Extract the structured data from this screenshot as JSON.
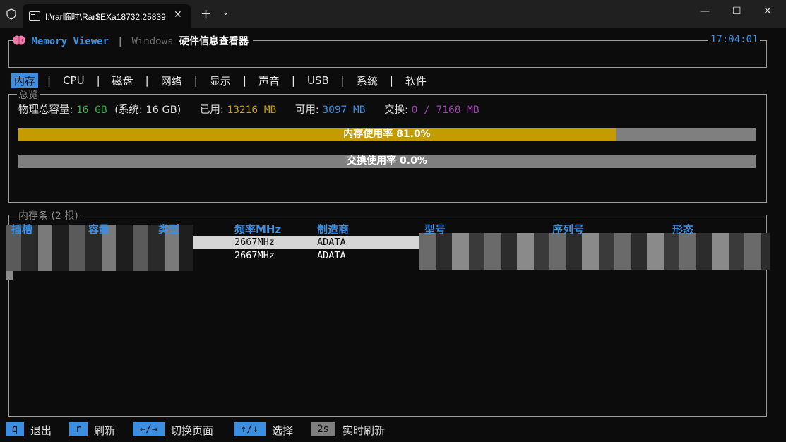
{
  "tab": {
    "title": "I:\\rar临时\\Rar$EXa18732.25839"
  },
  "window_controls": {
    "minimize": "—",
    "maximize": "☐",
    "close": "✕"
  },
  "header": {
    "app_name": "Memory Viewer",
    "separator": "|",
    "windows_label": "Windows",
    "subtitle": "硬件信息查看器",
    "clock": "17:04:01"
  },
  "menu": {
    "items": [
      "内存",
      "CPU",
      "磁盘",
      "网络",
      "显示",
      "声音",
      "USB",
      "系统",
      "软件"
    ],
    "active_index": 0
  },
  "overview": {
    "legend": "总览",
    "total_label": "物理总容量:",
    "total_value": "16 GB",
    "system_text": "(系统: 16 GB)",
    "used_label": "已用:",
    "used_value": "13216 MB",
    "avail_label": "可用:",
    "avail_value": "3097 MB",
    "swap_label": "交换:",
    "swap_value": "0 / 7168 MB",
    "mem_bar": {
      "label": "内存使用率 81.0%",
      "percent": 81.0
    },
    "swap_bar": {
      "label": "交换使用率 0.0%",
      "percent": 0.0
    }
  },
  "modules": {
    "legend": "内存条 (2 根)",
    "columns": [
      "插槽",
      "容量",
      "类型",
      "频率MHz",
      "制造商",
      "型号",
      "序列号",
      "形态"
    ],
    "rows": [
      {
        "freq": "2667MHz",
        "maker": "ADATA",
        "selected": true
      },
      {
        "freq": "2667MHz",
        "maker": "ADATA",
        "selected": false
      }
    ]
  },
  "footer": {
    "keys": [
      {
        "key": "q",
        "label": "退出"
      },
      {
        "key": "r",
        "label": "刷新"
      },
      {
        "key": "←/→",
        "label": "切换页面"
      },
      {
        "key": "↑/↓",
        "label": "选择"
      },
      {
        "key": "2s",
        "label": "实时刷新"
      }
    ]
  },
  "colors": {
    "accent": "#3b8ee0",
    "green": "#2fb24a",
    "yellow": "#c8a000",
    "purple": "#a040b0",
    "bar_fill": "#c49c00",
    "bar_track": "#7f7f7f"
  }
}
